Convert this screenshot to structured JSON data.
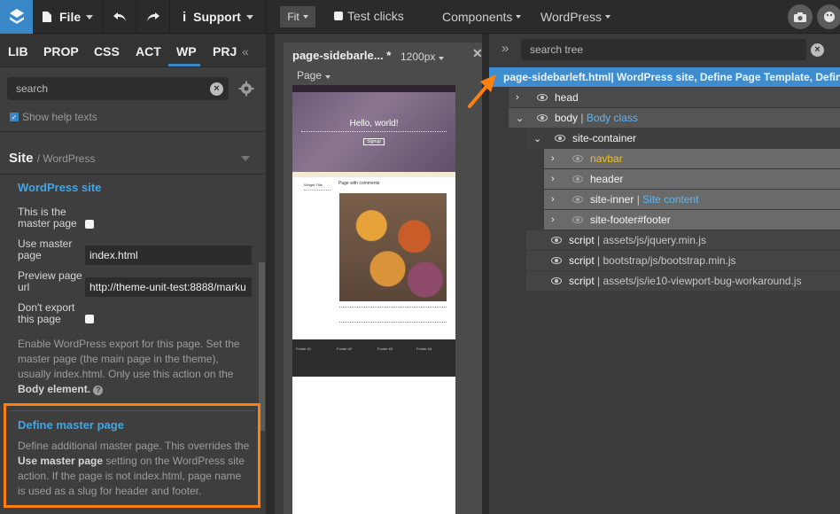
{
  "topbar": {
    "file_label": "File",
    "support_label": "Support",
    "fit_label": "Fit",
    "test_clicks_label": "Test clicks",
    "components_label": "Components",
    "wordpress_label": "WordPress"
  },
  "left": {
    "tabs": [
      "LIB",
      "PROP",
      "CSS",
      "ACT",
      "WP",
      "PRJ"
    ],
    "active_tab": "WP",
    "search_placeholder": "search",
    "show_help_texts": "Show help texts",
    "site_heading": "Site",
    "site_sub": "/ WordPress",
    "wp_section_title": "WordPress site",
    "master_label_1": "This is the",
    "master_label_2": "master page",
    "use_master_1": "Use master",
    "use_master_2": "page",
    "use_master_value": "index.html",
    "preview_label_1": "Preview page",
    "preview_label_2": "url",
    "preview_value": "http://theme-unit-test:8888/marku",
    "dont_export_1": "Don't export",
    "dont_export_2": "this page",
    "desc1_a": "Enable WordPress export for this page. Set the master page (the main page in the theme), usually index.html. Only use this action on the ",
    "desc1_b": "Body element.",
    "define_title": "Define master page",
    "desc2_a": "Define additional master page. This overrides the ",
    "desc2_b": "Use master page",
    "desc2_c": " setting on the WordPress site action. If the page is not index.html, page name is used as a slug for header and footer."
  },
  "canvas": {
    "page_name": "page-sidebarle...",
    "page_modified": "*",
    "width_label": "1200px",
    "page_dropdown": "Page",
    "preview": {
      "hero_title": "Hello, world!",
      "hero_button": "Signup",
      "widget_title": "Widget Title",
      "post_title": "Page with comments",
      "footer_cols": [
        "Footer #1",
        "Footer #2",
        "Footer #3",
        "Footer #4"
      ]
    }
  },
  "tree": {
    "search_placeholder": "search tree",
    "rows": [
      {
        "name": "page-sidebarleft.html",
        "meta": " | WordPress site, Define Page Template, Define..."
      },
      {
        "name": "head",
        "meta": ""
      },
      {
        "name": "body",
        "meta": "Body class"
      },
      {
        "name": "site-container",
        "meta": ""
      },
      {
        "name": "navbar",
        "meta": ""
      },
      {
        "name": "header",
        "meta": ""
      },
      {
        "name": "site-inner",
        "meta": "Site content"
      },
      {
        "name": "site-footer#footer",
        "meta": ""
      },
      {
        "name": "script",
        "meta": "assets/js/jquery.min.js"
      },
      {
        "name": "script",
        "meta": "bootstrap/js/bootstrap.min.js"
      },
      {
        "name": "script",
        "meta": "assets/js/ie10-viewport-bug-workaround.js"
      }
    ]
  },
  "colors": {
    "accent": "#3a87c8",
    "highlight": "#ff7f0f",
    "link": "#5cb6f2",
    "navbar_label": "#f1c40f"
  }
}
